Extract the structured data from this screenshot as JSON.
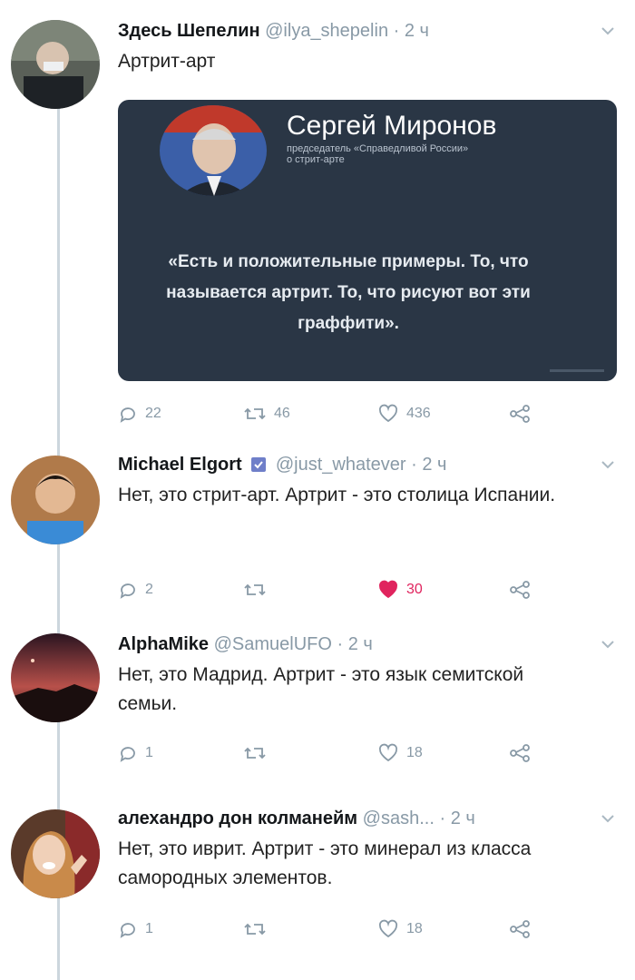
{
  "tweets": [
    {
      "name": "Здесь Шепелин",
      "handle": "@ilya_shepelin",
      "time": "2 ч",
      "text": "Артрит-арт",
      "card": {
        "name": "Сергей Миронов",
        "subtitle_line1": "председатель «Справедливой России»",
        "subtitle_line2": "о стрит-арте",
        "quote": "«Есть и положительные примеры. То, что называется артрит. То, что рисуют вот эти граффити»."
      },
      "replies": "22",
      "retweets": "46",
      "likes": "436"
    },
    {
      "name": "Michael Elgort",
      "handle": "@just_whatever",
      "time": "2 ч",
      "text": "Нет, это стрит-арт. Артрит - это столица Испании.",
      "replies": "2",
      "retweets": "",
      "likes": "30",
      "liked": true
    },
    {
      "name": "AlphaMike",
      "handle": "@SamuelUFO",
      "time": "2 ч",
      "text": "Нет, это Мадрид. Артрит - это язык семитской семьи.",
      "replies": "1",
      "retweets": "",
      "likes": "18"
    },
    {
      "name": "алехандро дон колманейм",
      "handle": "@sash...",
      "time": "2 ч",
      "text": "Нет, это иврит. Артрит - это минерал из класса самородных элементов.",
      "replies": "1",
      "retweets": "",
      "likes": "18"
    }
  ],
  "separator": "·",
  "colors": {
    "like_active": "#e0245e",
    "icon_gray": "#8899a6",
    "card_bg": "#2a3645"
  },
  "icons": [
    "reply-icon",
    "retweet-icon",
    "like-icon",
    "share-icon",
    "chevron-down-icon",
    "verified-icon"
  ]
}
